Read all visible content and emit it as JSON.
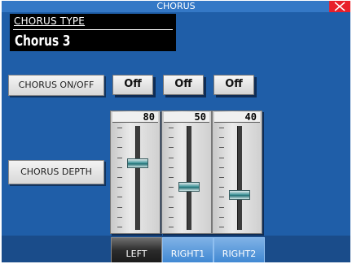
{
  "window": {
    "title": "CHORUS"
  },
  "chorus_type": {
    "label": "CHORUS TYPE",
    "value": "Chorus 3"
  },
  "chorus_onoff": {
    "label": "CHORUS ON/OFF",
    "buttons": [
      "Off",
      "Off",
      "Off"
    ]
  },
  "chorus_depth": {
    "label": "CHORUS DEPTH",
    "faders": [
      {
        "value": "80",
        "level": 80
      },
      {
        "value": "50",
        "level": 50
      },
      {
        "value": "40",
        "level": 40
      }
    ]
  },
  "tabs": [
    {
      "label": "LEFT",
      "active": true
    },
    {
      "label": "RIGHT1",
      "active": false
    },
    {
      "label": "RIGHT2",
      "active": false
    }
  ],
  "colors": {
    "background": "#1f5ea8",
    "close": "#e8202a",
    "knob": "#3a9aa0"
  }
}
